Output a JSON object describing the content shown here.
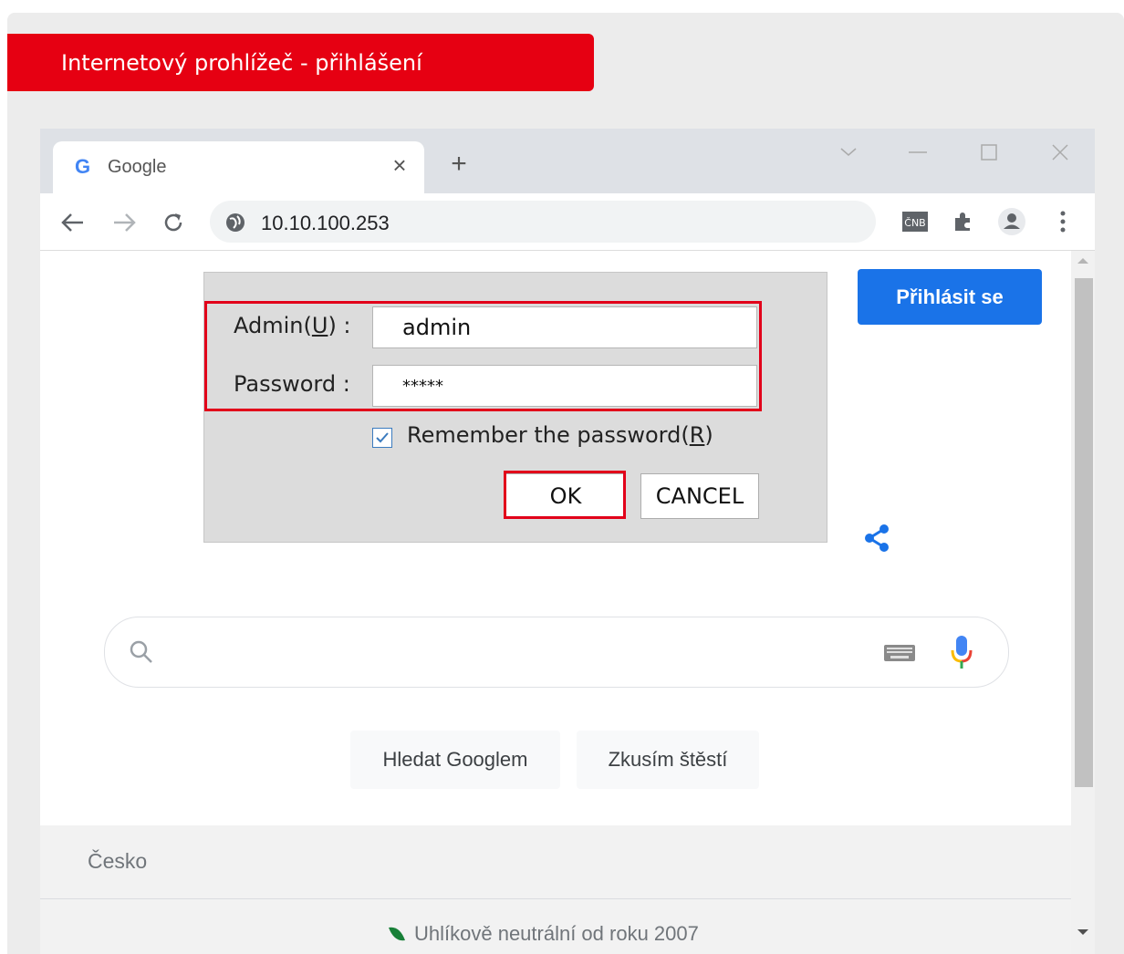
{
  "banner": {
    "title": "Internetový prohlížeč - přihlášení"
  },
  "browser": {
    "tab": {
      "favicon": "G",
      "title": "Google",
      "close_label": "×"
    },
    "new_tab_label": "+",
    "address": {
      "url": "10.10.100.253"
    },
    "toolbar_icons": [
      "back-icon",
      "forward-icon",
      "reload-icon",
      "site-info-icon",
      "extension-cnb-icon",
      "puzzle-icon",
      "profile-icon",
      "menu-icon"
    ]
  },
  "google": {
    "signin_label": "Přihlásit se",
    "search_button": "Hledat Googlem",
    "lucky_button": "Zkusím štěstí",
    "country": "Česko",
    "carbon_text": "Uhlíkově neutrální od roku 2007"
  },
  "dialog": {
    "admin_label": "Admin(U) :",
    "admin_value": "admin",
    "password_label": "Password :",
    "password_value": "*****",
    "remember_label": "Remember the password(R)",
    "remember_checked": true,
    "ok_label": "OK",
    "cancel_label": "CANCEL"
  },
  "colors": {
    "accent_red": "#e60012",
    "google_blue": "#1a73e8"
  }
}
